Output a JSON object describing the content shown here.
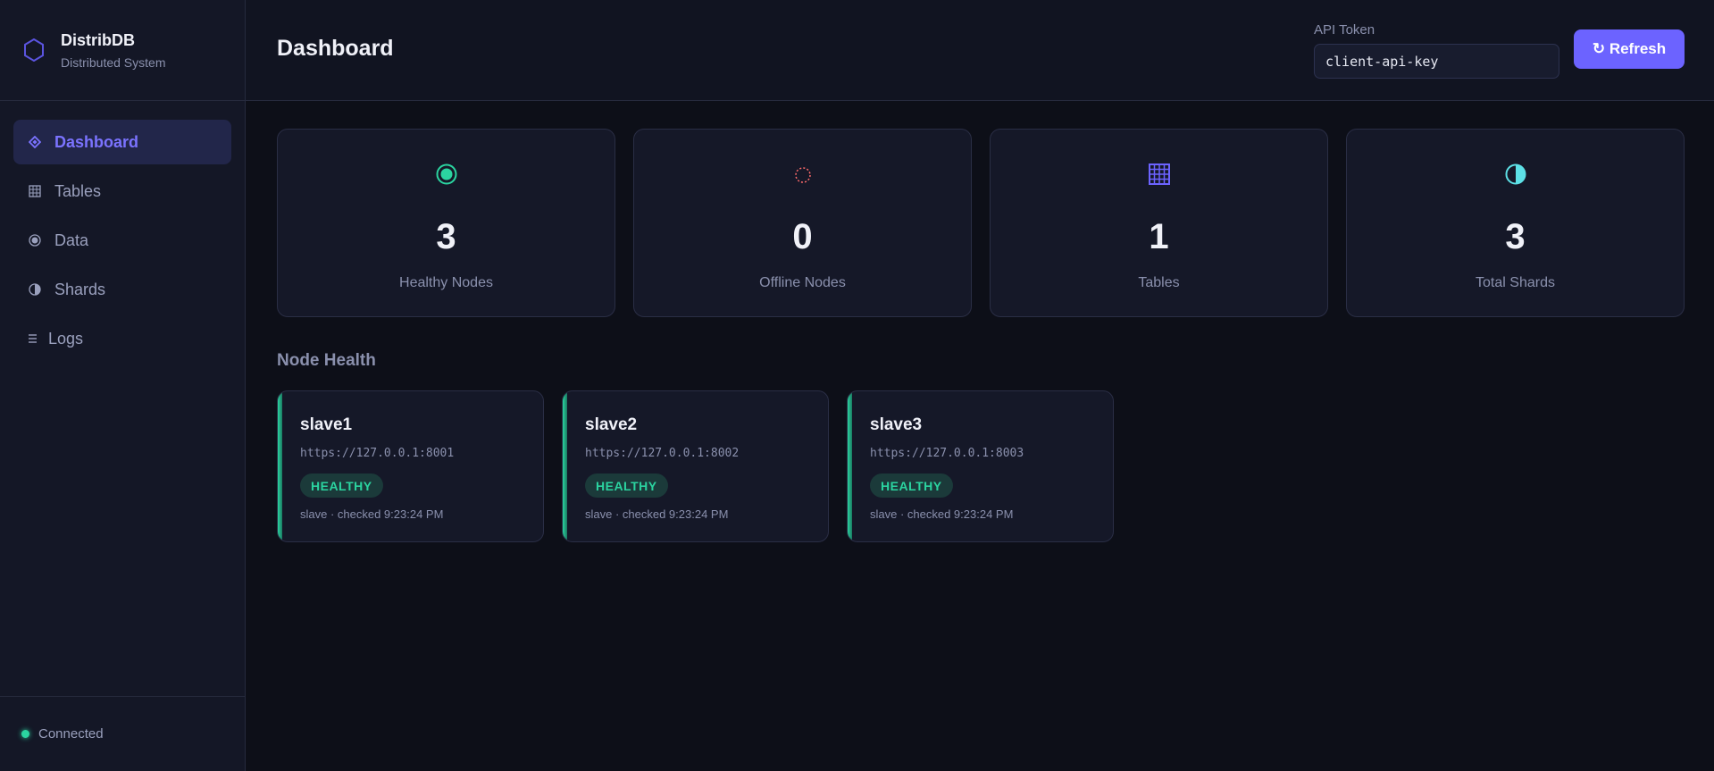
{
  "brand": {
    "title": "DistribDB",
    "subtitle": "Distributed System",
    "icon": "hexagon-icon"
  },
  "sidebar": {
    "items": [
      {
        "label": "Dashboard",
        "icon": "diamond-icon",
        "active": true
      },
      {
        "label": "Tables",
        "icon": "grid-icon",
        "active": false
      },
      {
        "label": "Data",
        "icon": "target-icon",
        "active": false
      },
      {
        "label": "Shards",
        "icon": "half-circle-icon",
        "active": false
      },
      {
        "label": "Logs",
        "icon": "list-icon",
        "active": false
      }
    ],
    "status": "Connected"
  },
  "header": {
    "title": "Dashboard",
    "token_label": "API Token",
    "token_value": "client-api-key",
    "refresh_label": "↻ Refresh"
  },
  "stats": [
    {
      "value": "3",
      "label": "Healthy Nodes",
      "icon": "target-icon"
    },
    {
      "value": "0",
      "label": "Offline Nodes",
      "icon": "dotted-circle-icon"
    },
    {
      "value": "1",
      "label": "Tables",
      "icon": "grid-icon"
    },
    {
      "value": "3",
      "label": "Total Shards",
      "icon": "half-circle-icon"
    }
  ],
  "node_health": {
    "title": "Node Health",
    "nodes": [
      {
        "name": "slave1",
        "url": "https://127.0.0.1:8001",
        "status": "HEALTHY",
        "meta": "slave · checked 9:23:24 PM"
      },
      {
        "name": "slave2",
        "url": "https://127.0.0.1:8002",
        "status": "HEALTHY",
        "meta": "slave · checked 9:23:24 PM"
      },
      {
        "name": "slave3",
        "url": "https://127.0.0.1:8003",
        "status": "HEALTHY",
        "meta": "slave · checked 9:23:24 PM"
      }
    ]
  },
  "colors": {
    "accent": "#6c63ff",
    "healthy": "#2bd4a0",
    "offline": "#ff6b6b",
    "background": "#0d0f18"
  }
}
